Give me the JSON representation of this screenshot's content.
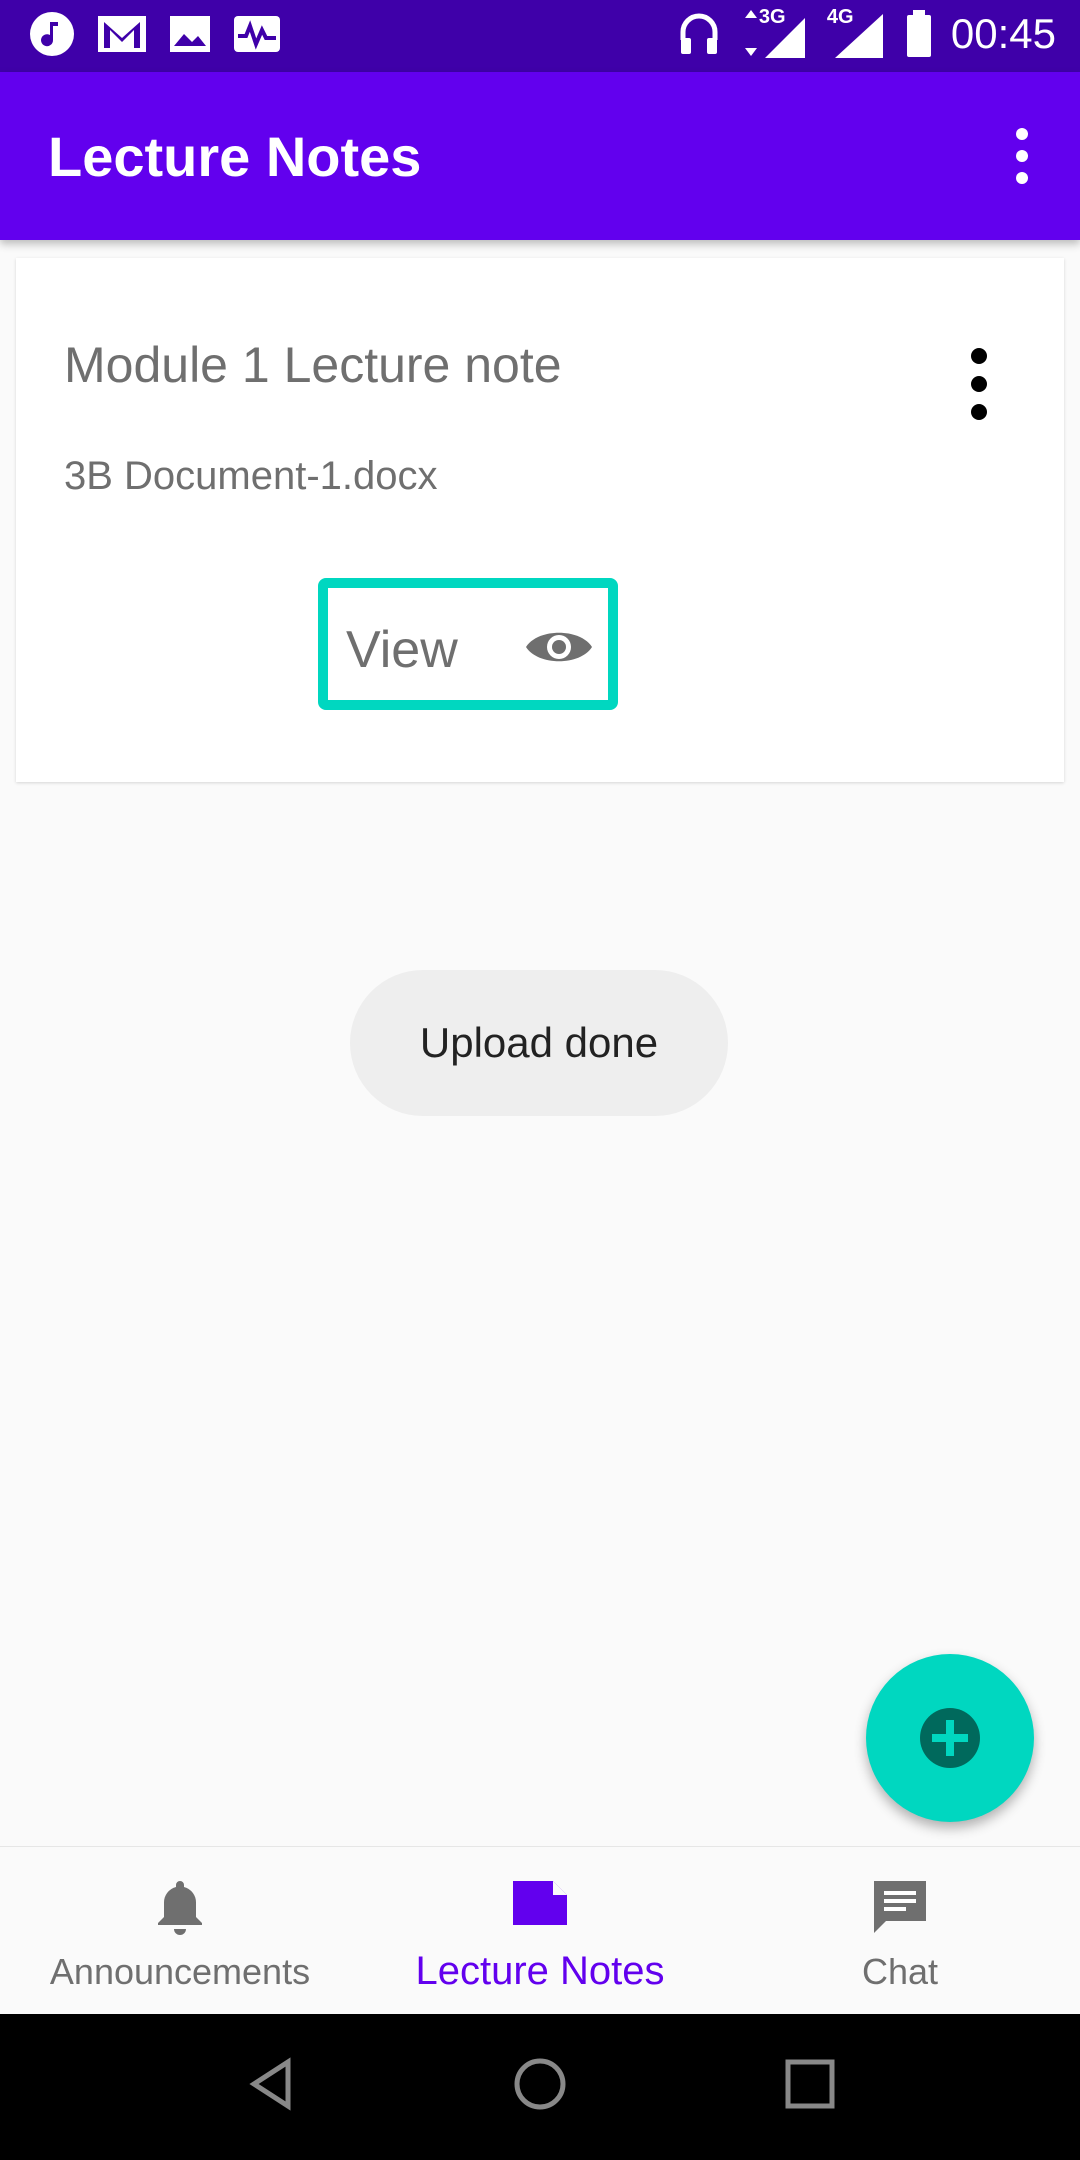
{
  "status_bar": {
    "time": "00:45",
    "left_icons": [
      "music-icon",
      "gmail-icon",
      "image-icon",
      "activity-icon"
    ],
    "right_icons": [
      "headset-icon",
      "3g-signal-icon",
      "4g-signal-icon",
      "battery-icon"
    ],
    "network_3g": "3G",
    "network_4g": "4G"
  },
  "app_bar": {
    "title": "Lecture Notes",
    "color": "#6200ee"
  },
  "note_card": {
    "title": "Module 1 Lecture note",
    "file": "3B Document-1.docx",
    "view_label": "View",
    "accent": "#00d7c0"
  },
  "toast": {
    "message": "Upload done"
  },
  "bottom_nav": {
    "items": [
      {
        "label": "Announcements",
        "icon": "bell-icon"
      },
      {
        "label": "Lecture Notes",
        "icon": "note-icon",
        "active": true
      },
      {
        "label": "Chat",
        "icon": "chat-icon"
      }
    ]
  }
}
